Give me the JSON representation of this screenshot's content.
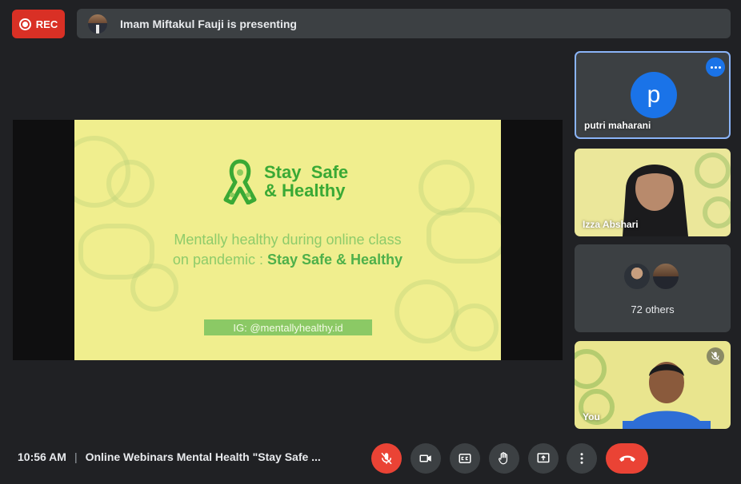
{
  "recording": {
    "label": "REC",
    "color": "#d93025"
  },
  "presenting_bar": {
    "text": "Imam Miftakul Fauji is presenting"
  },
  "slide": {
    "logo_line1": "Stay  Safe",
    "logo_line2": "& Healthy",
    "subtitle_line1": "Mentally healthy during online class",
    "subtitle_line2_prefix": "on pandemic : ",
    "subtitle_line2_bold": "Stay Safe & Healthy",
    "instagram": "IG: @mentallyhealthy.id",
    "background": "#f0ee8e"
  },
  "tiles": {
    "putri": {
      "avatar_letter": "p",
      "name": "putri maharani",
      "more_icon": "more-horiz-icon"
    },
    "izza": {
      "name": "Izza Abshari"
    },
    "others": {
      "label": "72 others"
    },
    "you": {
      "name": "You",
      "mic_icon": "mic-off-icon"
    }
  },
  "bottom_bar": {
    "time": "10:56 AM",
    "separator": "|",
    "meeting_title": "Online Webinars Mental Health \"Stay Safe ...",
    "controls": [
      {
        "icon": "mic-off-icon",
        "color": "#ea4335"
      },
      {
        "icon": "camera-icon"
      },
      {
        "icon": "captions-icon"
      },
      {
        "icon": "raise-hand-icon"
      },
      {
        "icon": "present-screen-icon"
      },
      {
        "icon": "more-vert-icon"
      },
      {
        "icon": "end-call-icon",
        "color": "#ea4335"
      }
    ]
  }
}
